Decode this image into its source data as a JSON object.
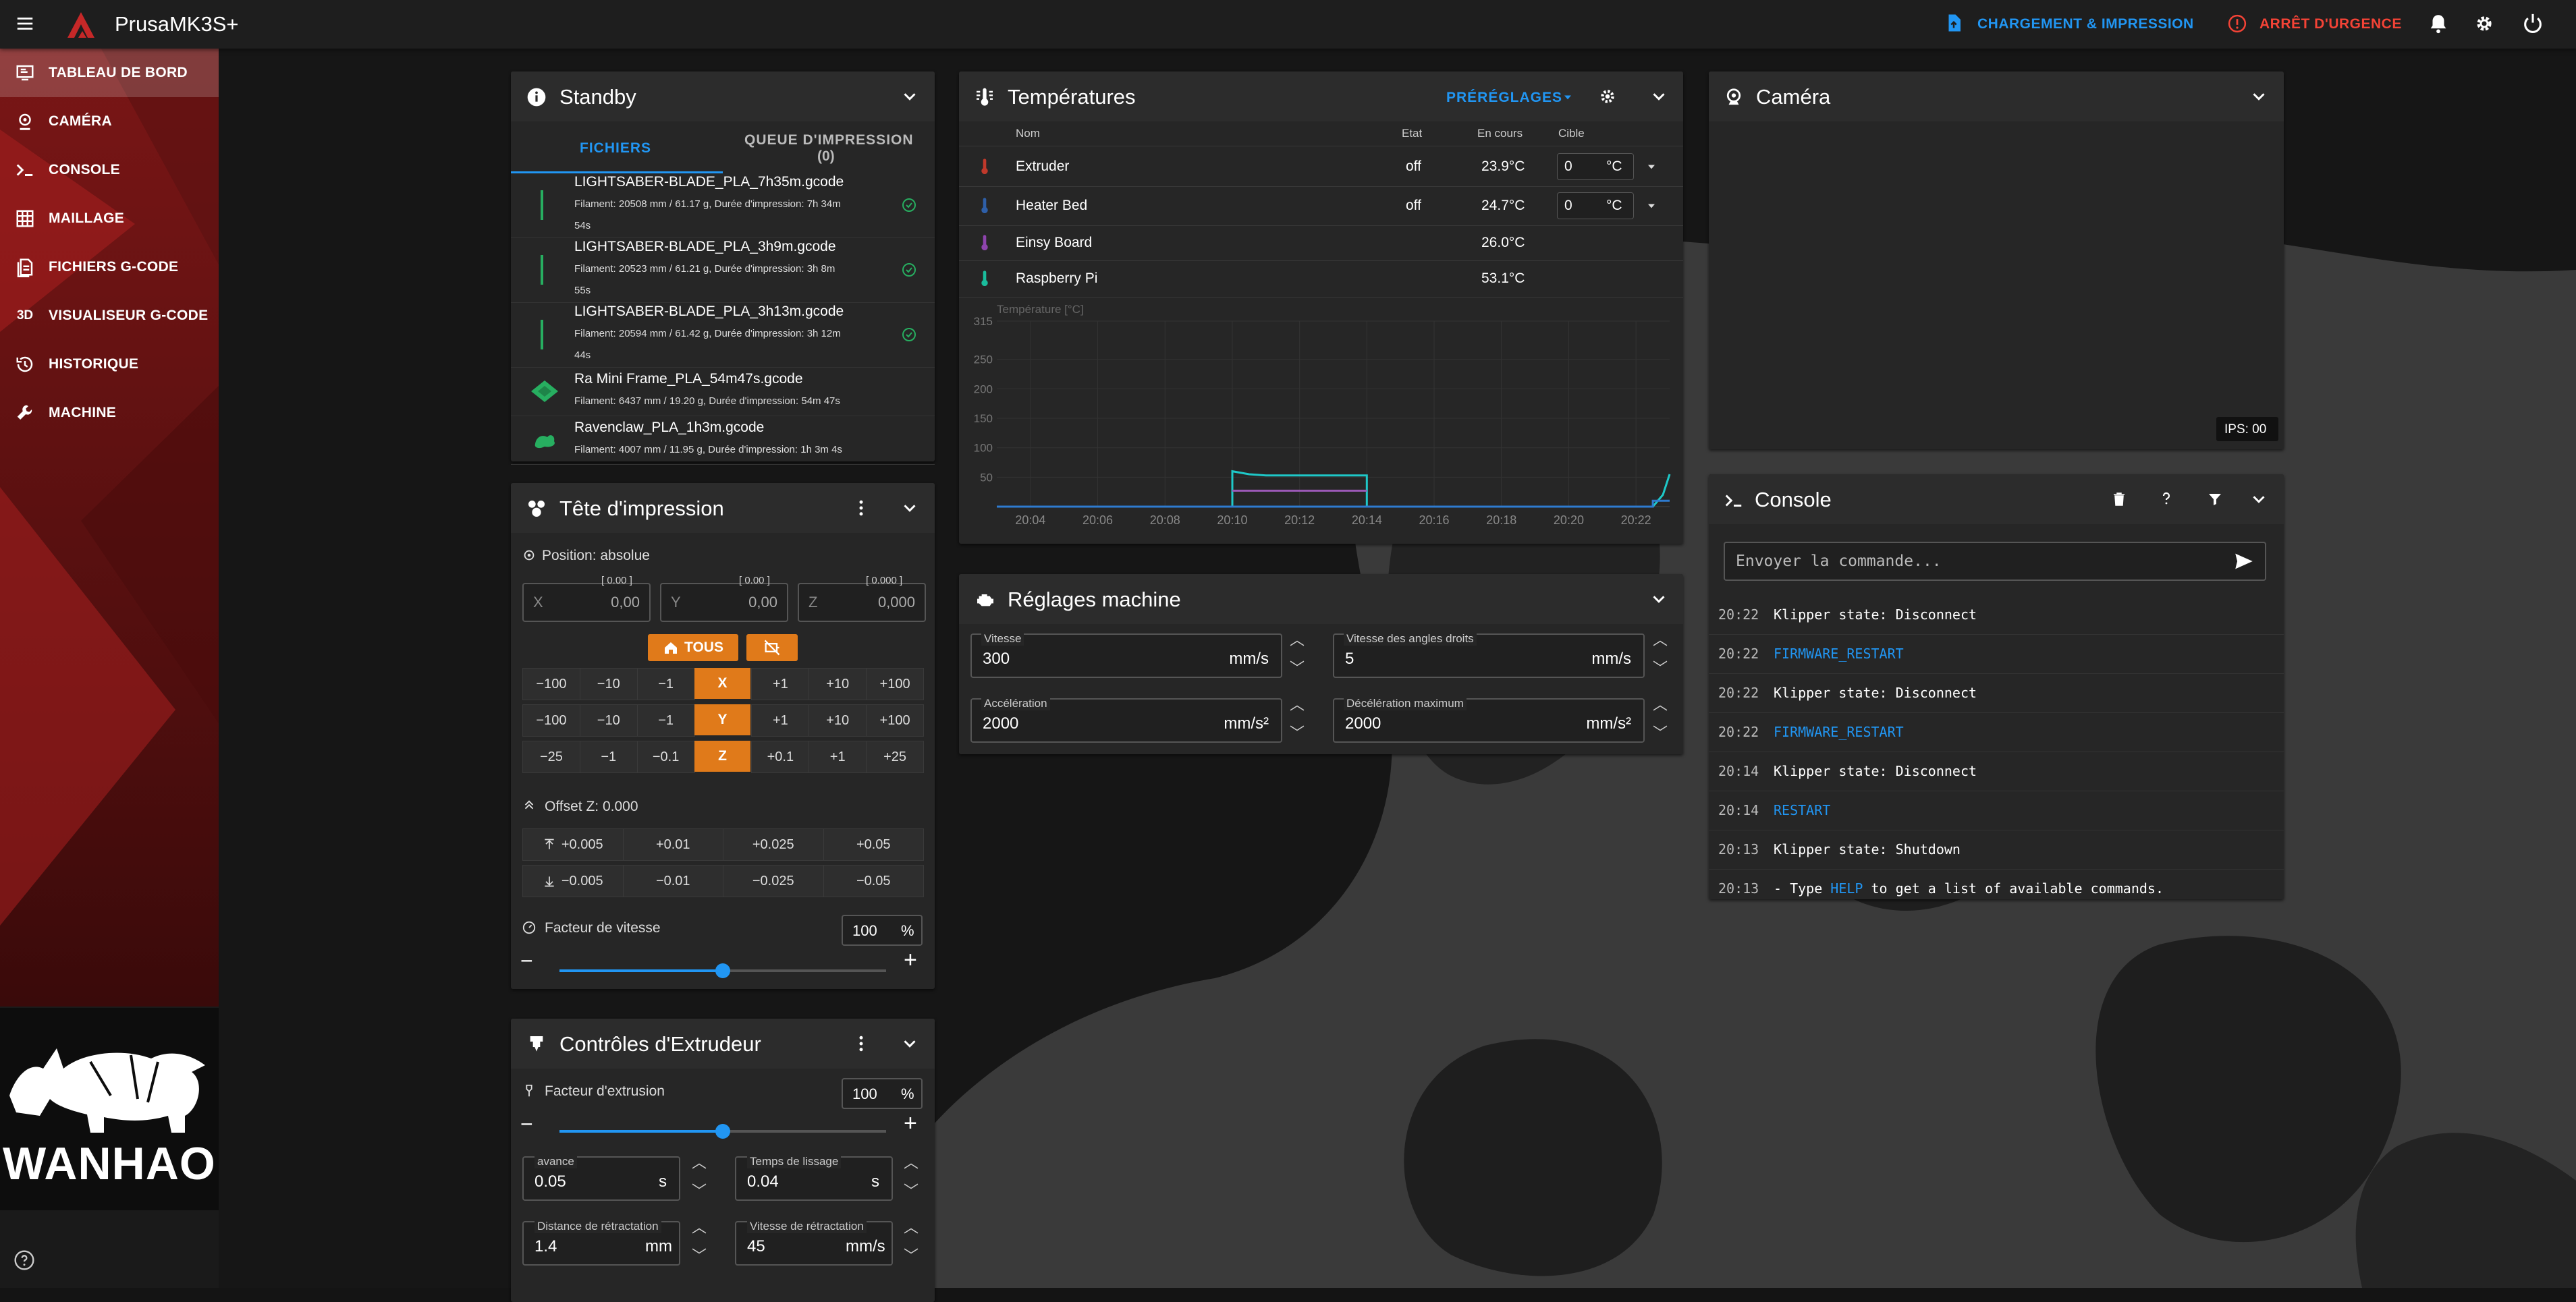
{
  "app": {
    "title": "PrusaMK3S+"
  },
  "topbar": {
    "upload_label": "CHARGEMENT & IMPRESSION",
    "estop_label": "ARRÊT D'URGENCE"
  },
  "sidebar": {
    "items": [
      {
        "label": "TABLEAU DE BORD",
        "icon": "dashboard-icon",
        "active": true
      },
      {
        "label": "CAMÉRA",
        "icon": "webcam-icon"
      },
      {
        "label": "CONSOLE",
        "icon": "console-icon"
      },
      {
        "label": "MAILLAGE",
        "icon": "grid-icon"
      },
      {
        "label": "FICHIERS G-CODE",
        "icon": "file-icon"
      },
      {
        "label": "VISUALISEUR G-CODE",
        "icon": "3d-icon"
      },
      {
        "label": "HISTORIQUE",
        "icon": "history-icon"
      },
      {
        "label": "MACHINE",
        "icon": "wrench-icon"
      }
    ],
    "brand": "WANHAO",
    "icon3d": "3D"
  },
  "standby": {
    "title": "Standby",
    "tabs": [
      "FICHIERS",
      "QUEUE D'IMPRESSION",
      "(0)"
    ],
    "files": [
      {
        "name": "LIGHTSABER-BLADE_PLA_7h35m.gcode",
        "line1": "Filament: 20508 mm / 61.17 g, Durée d'impression: 7h 34m",
        "line2": "54s"
      },
      {
        "name": "LIGHTSABER-BLADE_PLA_3h9m.gcode",
        "line1": "Filament: 20523 mm / 61.21 g, Durée d'impression: 3h 8m",
        "line2": "55s"
      },
      {
        "name": "LIGHTSABER-BLADE_PLA_3h13m.gcode",
        "line1": "Filament: 20594 mm / 61.42 g, Durée d'impression: 3h 12m",
        "line2": "44s"
      },
      {
        "name": "Ra Mini Frame_PLA_54m47s.gcode",
        "line1": "Filament: 6437 mm / 19.20 g, Durée d'impression: 54m 47s",
        "line2": ""
      },
      {
        "name": "Ravenclaw_PLA_1h3m.gcode",
        "line1": "Filament: 4007 mm / 11.95 g, Durée d'impression: 1h 3m 4s",
        "line2": ""
      }
    ]
  },
  "toolhead": {
    "title": "Tête d'impression",
    "position_label": "Position: absolue",
    "x": {
      "label": "X",
      "value": "0,00",
      "hint": "[ 0.00 ]"
    },
    "y": {
      "label": "Y",
      "value": "0,00",
      "hint": "[ 0.00 ]"
    },
    "z": {
      "label": "Z",
      "value": "0,000",
      "hint": "[ 0.000 ]"
    },
    "home_all": "TOUS",
    "row_x": [
      "−100",
      "−10",
      "−1",
      "X",
      "+1",
      "+10",
      "+100"
    ],
    "row_y": [
      "−100",
      "−10",
      "−1",
      "Y",
      "+1",
      "+10",
      "+100"
    ],
    "row_z": [
      "−25",
      "−1",
      "−0.1",
      "Z",
      "+0.1",
      "+1",
      "+25"
    ],
    "offset_label": "Offset Z: 0.000",
    "offset_up": [
      "+0.005",
      "+0.01",
      "+0.025",
      "+0.05"
    ],
    "offset_down": [
      "−0.005",
      "−0.01",
      "−0.025",
      "−0.05"
    ],
    "speed_label": "Facteur de vitesse",
    "speed_value": "100",
    "speed_unit": "%",
    "speed_fraction": 0.5
  },
  "extruder": {
    "title": "Contrôles d'Extrudeur",
    "factor_label": "Facteur d'extrusion",
    "factor_value": "100",
    "factor_unit": "%",
    "factor_fraction": 0.5,
    "advance_label": "avance",
    "advance_value": "0.05",
    "advance_unit": "s",
    "smooth_label": "Temps de lissage",
    "smooth_value": "0.04",
    "smooth_unit": "s",
    "retract_dist_label": "Distance de rétractation",
    "retract_dist_value": "1.4",
    "retract_dist_unit": "mm",
    "retract_speed_label": "Vitesse de rétractation",
    "retract_speed_value": "45",
    "retract_speed_unit": "mm/s"
  },
  "temps": {
    "title": "Températures",
    "presets": "PRÉRÉGLAGES",
    "headers": [
      "Nom",
      "Etat",
      "En cours",
      "Cible"
    ],
    "rows": [
      {
        "name": "Extruder",
        "state": "off",
        "current": "23.9°C",
        "target": "0",
        "unit": "°C",
        "color": "#c0392b"
      },
      {
        "name": "Heater Bed",
        "state": "off",
        "current": "24.7°C",
        "target": "0",
        "unit": "°C",
        "color": "#2e5fa8"
      },
      {
        "name": "Einsy Board",
        "state": "",
        "current": "26.0°C",
        "target": "",
        "unit": "",
        "color": "#8e44ad"
      },
      {
        "name": "Raspberry Pi",
        "state": "",
        "current": "53.1°C",
        "target": "",
        "unit": "",
        "color": "#1abc9c"
      }
    ]
  },
  "chart_data": {
    "type": "line",
    "ylabel": "Température [°C]",
    "yticks": [
      50,
      100,
      150,
      200,
      250,
      315
    ],
    "ylim": [
      0,
      315
    ],
    "xticks": [
      "20:04",
      "20:06",
      "20:08",
      "20:10",
      "20:12",
      "20:14",
      "20:16",
      "20:18",
      "20:20",
      "20:22"
    ],
    "xlim": [
      20.03,
      20.23
    ],
    "series": [
      {
        "color": "#1ec8c8",
        "points": [
          [
            20.03,
            0
          ],
          [
            20.1,
            0
          ],
          [
            20.1,
            60
          ],
          [
            20.105,
            55
          ],
          [
            20.11,
            53
          ],
          [
            20.14,
            53
          ],
          [
            20.14,
            50
          ],
          [
            20.14,
            0
          ],
          [
            20.22,
            0
          ],
          [
            20.225,
            0
          ],
          [
            20.228,
            20
          ],
          [
            20.23,
            55
          ]
        ]
      },
      {
        "color": "#9b59b6",
        "points": [
          [
            20.1,
            27
          ],
          [
            20.14,
            27
          ]
        ]
      },
      {
        "color": "#2e7bcf",
        "points": [
          [
            20.03,
            0
          ],
          [
            20.225,
            0
          ],
          [
            20.225,
            10
          ],
          [
            20.23,
            10
          ]
        ]
      }
    ]
  },
  "machine": {
    "title": "Réglages machine",
    "speed_label": "Vitesse",
    "speed_value": "300",
    "speed_unit": "mm/s",
    "scv_label": "Vitesse des angles droits",
    "scv_value": "5",
    "scv_unit": "mm/s",
    "accel_label": "Accélération",
    "accel_value": "2000",
    "accel_unit": "mm/s²",
    "decel_label": "Décélération maximum",
    "decel_value": "2000",
    "decel_unit": "mm/s²"
  },
  "camera": {
    "title": "Caméra",
    "fps": "IPS: 00"
  },
  "console": {
    "title": "Console",
    "placeholder": "Envoyer la commande...",
    "lines": [
      {
        "time": "20:22",
        "text": "Klipper state: Disconnect",
        "link": false
      },
      {
        "time": "20:22",
        "text": "FIRMWARE_RESTART",
        "link": true
      },
      {
        "time": "20:22",
        "text": "Klipper state: Disconnect",
        "link": false
      },
      {
        "time": "20:22",
        "text": "FIRMWARE_RESTART",
        "link": true
      },
      {
        "time": "20:14",
        "text": "Klipper state: Disconnect",
        "link": false
      },
      {
        "time": "20:14",
        "text": "RESTART",
        "link": true
      },
      {
        "time": "20:13",
        "text": "Klipper state: Shutdown",
        "link": false
      },
      {
        "time": "20:13",
        "text_pre": "- Type ",
        "text_link": "HELP",
        "text_post": " to get a list of available commands.",
        "mixed": true
      }
    ]
  },
  "colors": {
    "accent": "#2196f3",
    "orange": "#e07a1a",
    "danger": "#f44336"
  }
}
